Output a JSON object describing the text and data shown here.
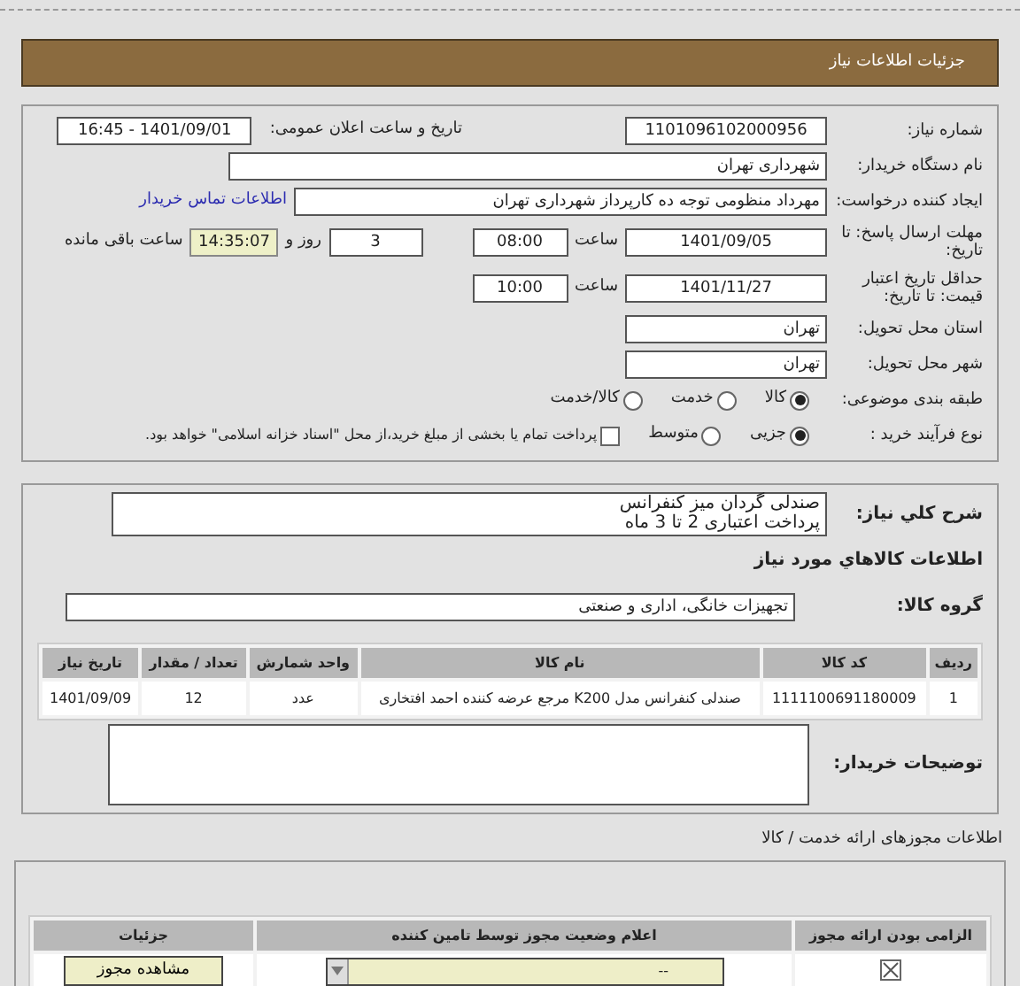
{
  "header": {
    "title": "جزئیات اطلاعات نیاز"
  },
  "need_info": {
    "need_number": {
      "label": "شماره نیاز:",
      "value": "1101096102000956"
    },
    "announce": {
      "label": "تاریخ و ساعت اعلان عمومی:",
      "value": "1401/09/01 - 16:45"
    },
    "buyer": {
      "label": "نام دستگاه خریدار:",
      "value": "شهرداری تهران"
    },
    "requester": {
      "label": "ایجاد کننده درخواست:",
      "value": "مهرداد منظومی توجه ده کارپرداز شهرداری تهران",
      "link": "اطلاعات تماس خریدار"
    },
    "deadline": {
      "label": "مهلت ارسال پاسخ: تا تاریخ:",
      "date": "1401/09/05",
      "time_label": "ساعت",
      "time": "08:00",
      "days": "3",
      "days_label": "روز و",
      "remaining": "14:35:07",
      "remaining_label": "ساعت باقی مانده"
    },
    "validity": {
      "label": "حداقل تاریخ اعتبار قیمت: تا تاریخ:",
      "date": "1401/11/27",
      "time_label": "ساعت",
      "time": "10:00"
    },
    "province": {
      "label": "استان محل تحویل:",
      "value": "تهران"
    },
    "city": {
      "label": "شهر محل تحویل:",
      "value": "تهران"
    },
    "category": {
      "label": "طبقه بندی موضوعی:",
      "options": [
        {
          "label": "کالا",
          "selected": true
        },
        {
          "label": "خدمت",
          "selected": false
        },
        {
          "label": "کالا/خدمت",
          "selected": false
        }
      ]
    },
    "process": {
      "label": "نوع فرآیند خرید :",
      "options": [
        {
          "label": "جزیی",
          "selected": true
        },
        {
          "label": "متوسط",
          "selected": false
        }
      ],
      "payment": {
        "label": "پرداخت تمام یا بخشی از مبلغ خرید،از محل \"اسناد خزانه اسلامی\" خواهد بود.",
        "checked": false
      }
    }
  },
  "description": {
    "label": "شرح کلي نياز:",
    "lines": [
      "صندلی گردان میز کنفرانس",
      "پرداخت اعتباری 2 تا 3 ماه"
    ]
  },
  "goods_heading": "اطلاعات کالاهاي مورد نياز",
  "group": {
    "label": "گروه کالا:",
    "value": "تجهیزات خانگی، اداری و صنعتی"
  },
  "goods_table": {
    "columns": [
      "ردیف",
      "کد کالا",
      "نام کالا",
      "واحد شمارش",
      "تعداد / مقدار",
      "تاریخ نیاز"
    ],
    "rows": [
      [
        "1",
        "1111100691180009",
        "صندلی کنفرانس مدل K200 مرجع عرضه کننده احمد افتخاری",
        "عدد",
        "12",
        "1401/09/09"
      ]
    ]
  },
  "buyer_notes": {
    "label": "توضیحات خریدار:"
  },
  "permits": {
    "title": "اطلاعات مجوزهای ارائه خدمت / کالا",
    "columns": [
      "الزامی بودن ارائه مجوز",
      "اعلام وضعیت مجوز توسط تامین کننده",
      "جزئیات"
    ],
    "rows": [
      {
        "required": true,
        "status": "--",
        "button": "مشاهده مجوز"
      }
    ]
  }
}
